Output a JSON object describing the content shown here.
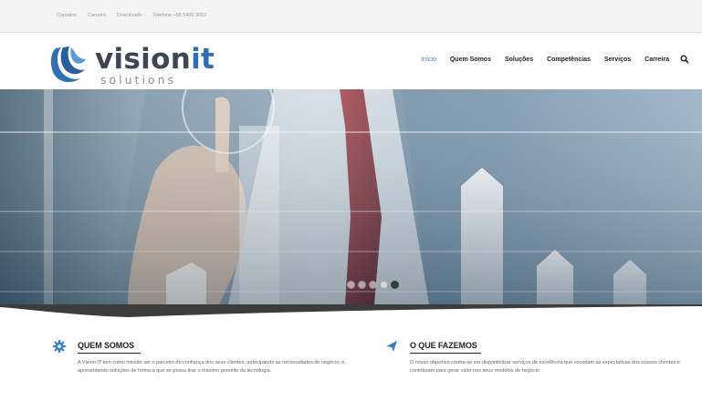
{
  "topbar": {
    "links": [
      "Contatos",
      "Carreira",
      "Downloads",
      "Telefone +55 5465 3002"
    ]
  },
  "brand": {
    "word_main": "vision",
    "word_accent": "it",
    "subline": "solutions"
  },
  "nav": {
    "items": [
      "Início",
      "Quem Somos",
      "Soluções",
      "Competências",
      "Serviços",
      "Carreira"
    ],
    "active_index": 0
  },
  "slider": {
    "dots_total": 5,
    "active_dot": 4
  },
  "sections": [
    {
      "title": "QUEM SOMOS",
      "icon": "gear-icon",
      "text": "A Vision IT tem como missão ser o parceiro de confiança dos seus clientes, antecipando as necessidades de negócio, e, apresentando soluções de forma a que se possa tirar o máximo proveito da tecnologia."
    },
    {
      "title": "O QUE FAZEMOS",
      "icon": "paper-plane-icon",
      "text": "O nosso objectivo centra-se em disponibilizar serviços de excelência que excedam as expectativas dos nossos clientes e contribuam para gerar valor nos seus modelos de negócio"
    }
  ],
  "colors": {
    "brand_blue": "#2f6fb4",
    "brand_dark": "#3d4652",
    "nav_active": "#3a86c8",
    "section_icon": "#3a86c8"
  }
}
